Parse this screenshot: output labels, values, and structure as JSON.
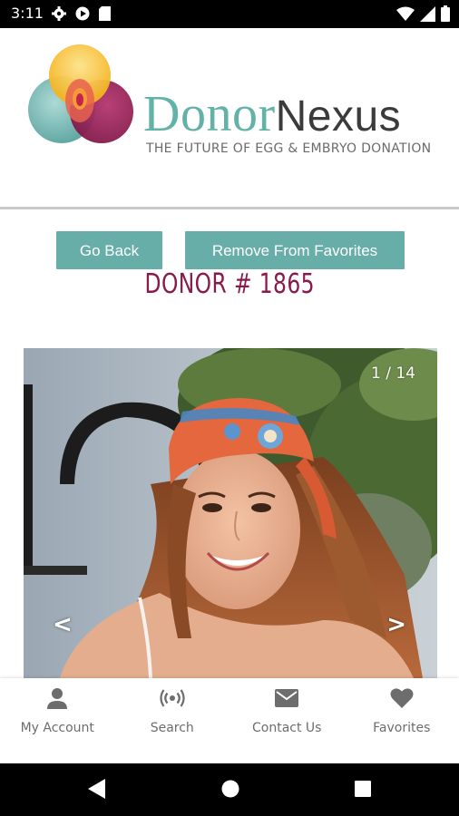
{
  "status_bar": {
    "time": "3:11",
    "left_icons": [
      "settings-gear-icon",
      "play-icon",
      "sd-card-icon"
    ],
    "right_icons": [
      "wifi-icon",
      "cellular-icon",
      "battery-icon"
    ]
  },
  "header": {
    "brand_part1": "Donor",
    "brand_part2": "Nexus",
    "tagline": "THE FUTURE OF EGG & EMBRYO DONATION"
  },
  "actions": {
    "go_back_label": "Go Back",
    "remove_label": "Remove From Favorites"
  },
  "donor": {
    "title": "DONOR # 1865"
  },
  "gallery": {
    "counter": "1 / 14",
    "prev_symbol": "<",
    "next_symbol": ">"
  },
  "bottom_nav": {
    "items": [
      {
        "label": "My Account",
        "icon": "person-icon"
      },
      {
        "label": "Search",
        "icon": "broadcast-icon"
      },
      {
        "label": "Contact Us",
        "icon": "mail-icon"
      },
      {
        "label": "Favorites",
        "icon": "heart-icon"
      }
    ]
  },
  "colors": {
    "accent": "#67aea9",
    "title": "#8a1a4b"
  }
}
